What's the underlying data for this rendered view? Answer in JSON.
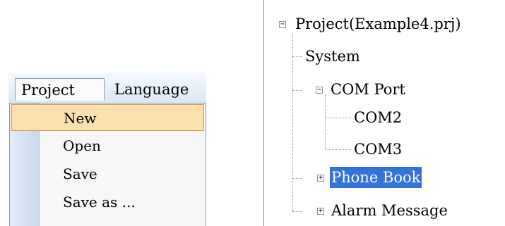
{
  "menubar": {
    "items": [
      {
        "label": "Project"
      },
      {
        "label": "Language"
      }
    ]
  },
  "dropdown": {
    "items": [
      {
        "label": "New",
        "selected": true
      },
      {
        "label": "Open"
      },
      {
        "label": "Save"
      },
      {
        "label": "Save as ..."
      }
    ]
  },
  "tree": {
    "root": {
      "label": "Project(Example4.prj)",
      "expanded": true
    },
    "nodes": [
      {
        "label": "System",
        "level": 1
      },
      {
        "label": "COM Port",
        "level": 1,
        "expanded": true
      },
      {
        "label": "COM2",
        "level": 2
      },
      {
        "label": "COM3",
        "level": 2
      },
      {
        "label": "Phone Book",
        "level": 1,
        "expanded": false,
        "selected": true
      },
      {
        "label": "Alarm Message",
        "level": 1,
        "expanded": false
      }
    ],
    "icons": {
      "collapse": "minus-box-icon",
      "expand": "plus-box-icon"
    },
    "selection_color": "#3173d9"
  }
}
